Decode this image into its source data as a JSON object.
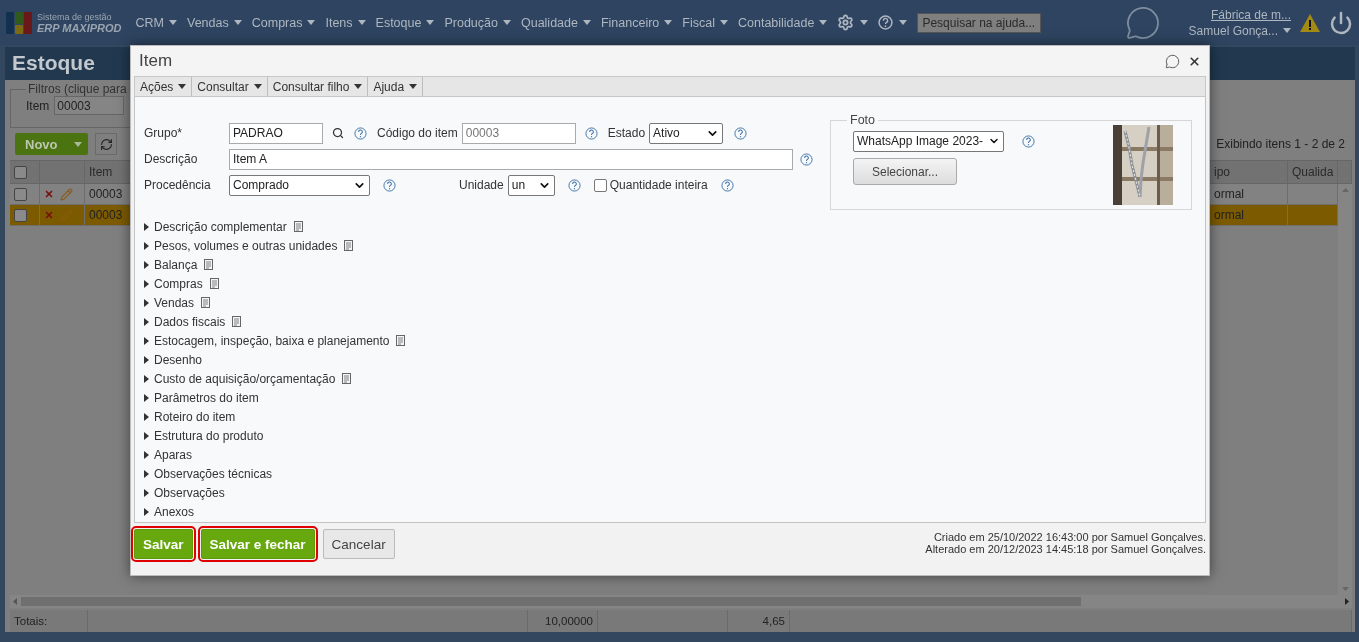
{
  "nav": {
    "logo": {
      "line1": "Sistema de gestão",
      "line2": "ERP MAXIPROD"
    },
    "menus": [
      "CRM",
      "Vendas",
      "Compras",
      "Itens",
      "Estoque",
      "Produção",
      "Qualidade",
      "Financeiro",
      "Fiscal",
      "Contabilidade"
    ],
    "search": {
      "placeholder": "Pesquisar na ajuda..."
    },
    "company": "Fábrica de m...",
    "user": "Samuel Gonça..."
  },
  "page": {
    "title": "Estoque",
    "filters": {
      "legend": "Filtros (clique para",
      "label": "Item",
      "value": "00003"
    },
    "toolbar": {
      "new_button": "Novo",
      "pager": "Exibindo itens 1 - 2 de 2"
    },
    "table": {
      "header_checked": false,
      "columns": [
        "Item",
        "ipo",
        "Qualida"
      ],
      "rows": [
        {
          "checked": false,
          "selected": false,
          "item": "00003",
          "column_2": "ormal"
        },
        {
          "checked": false,
          "selected": true,
          "item": "00003",
          "column_2": "ormal"
        }
      ]
    },
    "totals": {
      "label": "Totais:",
      "values": [
        "10,00000",
        "4,65"
      ]
    }
  },
  "dialog": {
    "title": "Item",
    "menus": [
      "Ações",
      "Consultar",
      "Consultar filho",
      "Ajuda"
    ],
    "form": {
      "grupo": {
        "label": "Grupo*",
        "value": "PADRAO"
      },
      "codigo": {
        "label": "Código do item",
        "value": "00003",
        "disabled": true
      },
      "estado": {
        "label": "Estado",
        "value": "Ativo"
      },
      "descricao": {
        "label": "Descrição",
        "value": "Item A"
      },
      "procedencia": {
        "label": "Procedência",
        "value": "Comprado"
      },
      "unidade": {
        "label": "Unidade",
        "value": "un"
      },
      "quantidade_inteira": {
        "label": "Quantidade inteira",
        "checked": false
      }
    },
    "foto": {
      "legend": "Foto",
      "file": "WhatsApp Image 2023-",
      "button": "Selecionar..."
    },
    "sections": [
      {
        "label": "Descrição complementar",
        "expanded": false,
        "note_icon": true
      },
      {
        "label": "Pesos, volumes e outras unidades",
        "expanded": false,
        "note_icon": true
      },
      {
        "label": "Balança",
        "expanded": false,
        "note_icon": true
      },
      {
        "label": "Compras",
        "expanded": false,
        "note_icon": true
      },
      {
        "label": "Vendas",
        "expanded": false,
        "note_icon": true
      },
      {
        "label": "Dados fiscais",
        "expanded": false,
        "note_icon": true
      },
      {
        "label": "Estocagem, inspeção, baixa e planejamento",
        "expanded": false,
        "note_icon": true
      },
      {
        "label": "Desenho",
        "expanded": false,
        "note_icon": false
      },
      {
        "label": "Custo de aquisição/orçamentação",
        "expanded": false,
        "note_icon": true
      },
      {
        "label": "Parâmetros do item",
        "expanded": false,
        "note_icon": false
      },
      {
        "label": "Roteiro do item",
        "expanded": false,
        "note_icon": false
      },
      {
        "label": "Estrutura do produto",
        "expanded": false,
        "note_icon": false
      },
      {
        "label": "Aparas",
        "expanded": false,
        "note_icon": false
      },
      {
        "label": "Observações técnicas",
        "expanded": false,
        "note_icon": false
      },
      {
        "label": "Observações",
        "expanded": false,
        "note_icon": false
      },
      {
        "label": "Anexos",
        "expanded": false,
        "note_icon": false
      }
    ],
    "buttons": [
      {
        "label": "Salvar",
        "kind": "primary",
        "highlighted": true
      },
      {
        "label": "Salvar e fechar",
        "kind": "primary",
        "highlighted": true
      },
      {
        "label": "Cancelar",
        "kind": "secondary",
        "highlighted": false
      }
    ],
    "audit": [
      "Criado em 25/10/2022 16:43:00 por Samuel Gonçalves.",
      "Alterado em 20/12/2023 14:45:18 por Samuel Gonçalves."
    ]
  }
}
